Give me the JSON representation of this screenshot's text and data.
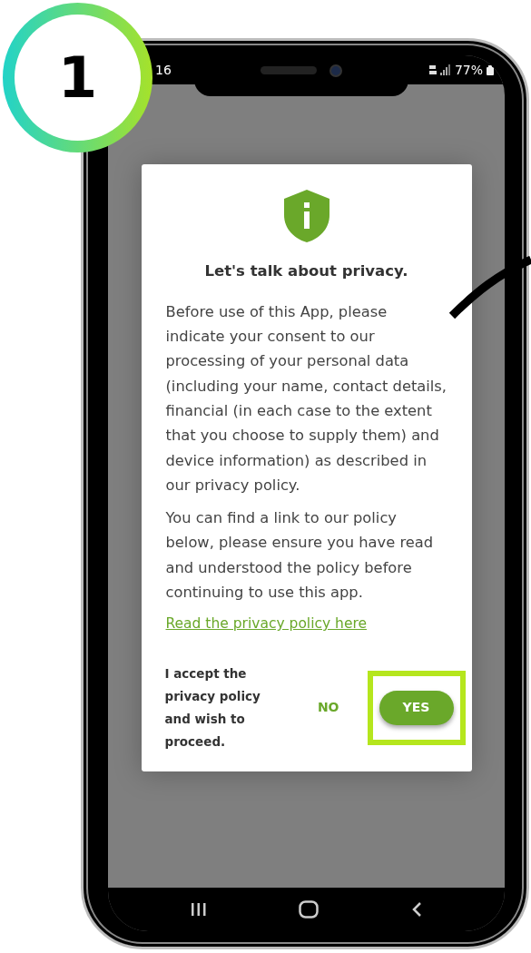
{
  "step_badge": "1",
  "status_bar": {
    "time": "16",
    "battery": "77%"
  },
  "dialog": {
    "title": "Let's talk about privacy.",
    "paragraphs": [
      "Before use of this App, please indicate your consent to our processing of your personal data (including your name, contact details, financial (in each case to the extent that you choose to supply them) and device information) as described in our privacy policy.",
      "You can find a link to our policy below, please ensure you have read and understood the policy before continuing to use this app."
    ],
    "link": "Read the privacy policy here",
    "consent_text": "I accept the privacy policy and wish to proceed.",
    "buttons": [
      {
        "label": "NO",
        "kind": "text",
        "highlighted": false
      },
      {
        "label": "YES",
        "kind": "filled",
        "highlighted": true
      }
    ]
  }
}
